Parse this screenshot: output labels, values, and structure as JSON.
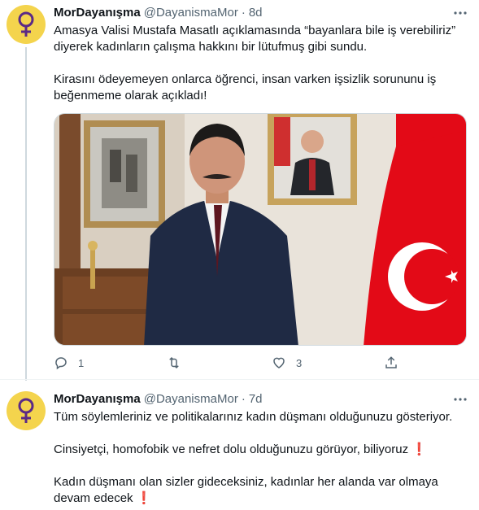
{
  "tweets": [
    {
      "author_name": "MorDayanışma",
      "handle": "@DayanismaMor",
      "separator": "·",
      "time": "8d",
      "avatar_icon": "venus-symbol-icon",
      "lines": [
        "Amasya Valisi Mustafa Masatlı açıklamasında “bayanlara bile iş verebiliriz”",
        "diyerek kadınların çalışma hakkını bir lütufmuş gibi sundu.",
        "",
        "Kirasını ödeyemeyen onlarca öğrenci, insan varken işsizlik sorununu iş",
        "beğenmeme olarak açıkladı!"
      ],
      "media": "photo of a man in a dark suit standing in an office with a Turkish flag and framed portraits",
      "reply_count": "1",
      "retweet_count": "",
      "like_count": "3"
    },
    {
      "author_name": "MorDayanışma",
      "handle": "@DayanismaMor",
      "separator": "·",
      "time": "7d",
      "avatar_icon": "venus-symbol-icon",
      "lines": [
        "Tüm söylemleriniz ve politikalarınız kadın düşmanı olduğunuzu gösteriyor.",
        "",
        "Cinsiyetçi, homofobik ve nefret dolu olduğunuzu görüyor, biliyoruz",
        "",
        "Kadın düşmanı olan sizler gideceksiniz, kadınlar her alanda var olmaya",
        "devam edecek"
      ],
      "emoji": "❗"
    }
  ],
  "colors": {
    "avatar_bg": "#f4d44d",
    "avatar_symbol": "#5b2a86",
    "secondary_text": "#536471",
    "thread_line": "#cfd9de",
    "flag_red": "#e30a17"
  }
}
